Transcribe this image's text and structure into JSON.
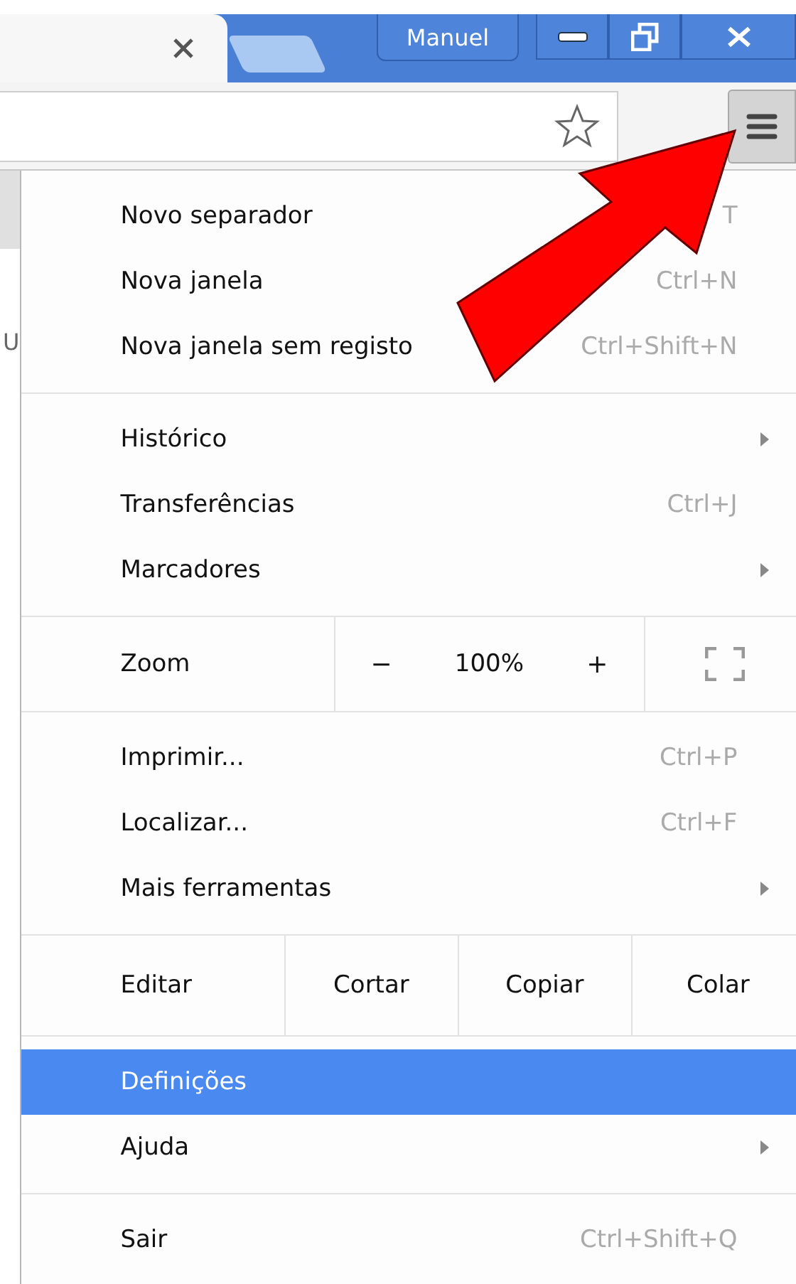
{
  "tabstrip": {
    "profile": "Manuel"
  },
  "page": {
    "fragment": "U"
  },
  "menu": [
    {
      "kind": "item",
      "label": "Novo separador",
      "shortcut": "T",
      "selected": false
    },
    {
      "kind": "item",
      "label": "Nova janela",
      "shortcut": "Ctrl+N",
      "selected": false
    },
    {
      "kind": "item",
      "label": "Nova janela sem registo",
      "shortcut": "Ctrl+Shift+N",
      "selected": false
    },
    {
      "kind": "divider"
    },
    {
      "kind": "item",
      "label": "Histórico",
      "submenu": true,
      "selected": false
    },
    {
      "kind": "item",
      "label": "Transferências",
      "shortcut": "Ctrl+J",
      "selected": false
    },
    {
      "kind": "item",
      "label": "Marcadores",
      "submenu": true,
      "selected": false
    },
    {
      "kind": "divider"
    },
    {
      "kind": "zoom",
      "label": "Zoom",
      "minus": "−",
      "value": "100%",
      "plus": "+"
    },
    {
      "kind": "divider"
    },
    {
      "kind": "item",
      "label": "Imprimir...",
      "shortcut": "Ctrl+P",
      "selected": false
    },
    {
      "kind": "item",
      "label": "Localizar...",
      "shortcut": "Ctrl+F",
      "selected": false
    },
    {
      "kind": "item",
      "label": "Mais ferramentas",
      "submenu": true,
      "selected": false
    },
    {
      "kind": "divider"
    },
    {
      "kind": "edit",
      "label": "Editar",
      "actions": [
        "Cortar",
        "Copiar",
        "Colar"
      ]
    },
    {
      "kind": "divider"
    },
    {
      "kind": "item",
      "label": "Definições",
      "selected": true
    },
    {
      "kind": "item",
      "label": "Ajuda",
      "submenu": true,
      "selected": false
    },
    {
      "kind": "divider"
    },
    {
      "kind": "item",
      "label": "Sair",
      "shortcut": "Ctrl+Shift+Q",
      "selected": false
    }
  ]
}
